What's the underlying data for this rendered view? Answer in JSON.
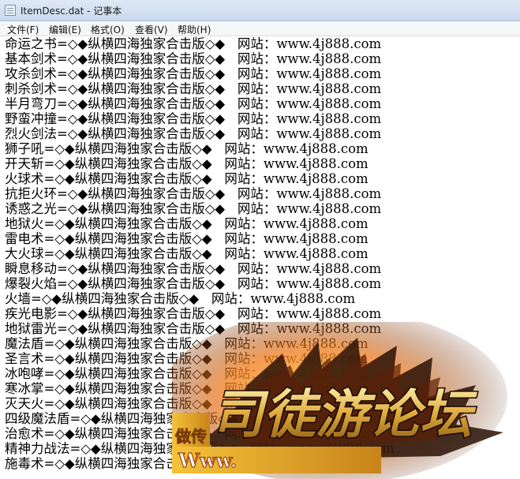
{
  "window": {
    "title": "ItemDesc.dat - 记事本"
  },
  "menu": [
    {
      "label": "文件(F)"
    },
    {
      "label": "编辑(E)"
    },
    {
      "label": "格式(O)"
    },
    {
      "label": "查看(V)"
    },
    {
      "label": "帮助(H)"
    }
  ],
  "lines": [
    "命运之书=◇◆纵横四海独家合击版◇◆   网站：www.4j888.com",
    "基本剑术=◇◆纵横四海独家合击版◇◆   网站：www.4j888.com",
    "攻杀剑术=◇◆纵横四海独家合击版◇◆   网站：www.4j888.com",
    "刺杀剑术=◇◆纵横四海独家合击版◇◆   网站：www.4j888.com",
    "半月弯刀=◇◆纵横四海独家合击版◇◆   网站：www.4j888.com",
    "野蛮冲撞=◇◆纵横四海独家合击版◇◆   网站：www.4j888.com",
    "烈火剑法=◇◆纵横四海独家合击版◇◆   网站：www.4j888.com",
    "狮子吼=◇◆纵横四海独家合击版◇◆   网站：www.4j888.com",
    "开天斩=◇◆纵横四海独家合击版◇◆   网站：www.4j888.com",
    "火球术=◇◆纵横四海独家合击版◇◆   网站：www.4j888.com",
    "抗拒火环=◇◆纵横四海独家合击版◇◆   网站：www.4j888.com",
    "诱惑之光=◇◆纵横四海独家合击版◇◆   网站：www.4j888.com",
    "地狱火=◇◆纵横四海独家合击版◇◆   网站：www.4j888.com",
    "雷电术=◇◆纵横四海独家合击版◇◆   网站：www.4j888.com",
    "大火球=◇◆纵横四海独家合击版◇◆   网站：www.4j888.com",
    "瞬息移动=◇◆纵横四海独家合击版◇◆   网站：www.4j888.com",
    "爆裂火焰=◇◆纵横四海独家合击版◇◆   网站：www.4j888.com",
    "火墙=◇◆纵横四海独家合击版◇◆   网站：www.4j888.com",
    "疾光电影=◇◆纵横四海独家合击版◇◆   网站：www.4j888.com",
    "地狱雷光=◇◆纵横四海独家合击版◇◆   网站：www.4j888.com",
    "魔法盾=◇◆纵横四海独家合击版◇◆   网站：www.4j888.com",
    "圣言术=◇◆纵横四海独家合击版◇◆   网站：www.4j888.com",
    "冰咆哮=◇◆纵横四海独家合击版◇◆   网站：www.4j888.com",
    "寒冰掌=◇◆纵横四海独家合击版◇◆   网站：www.4j888.com",
    "灭天火=◇◆纵横四海独家合击版◇◆   网站：www.4j888.com",
    "四级魔法盾=◇◆纵横四海独家合击版◇◆   网站：www.4j888.com",
    "治愈术=◇◆纵横四海独家合击版◇◆   网站：www.4j888.com",
    "精神力战法=◇◆纵横四海独家合击版◇◆   网站：www.4j888.com",
    "施毒术=◇◆纵横四海独家合击版◇◆   网站：www.4j888.com"
  ],
  "watermark": {
    "logo_text": "司徒游论坛",
    "side_text": "做传",
    "url_text": "Www."
  }
}
